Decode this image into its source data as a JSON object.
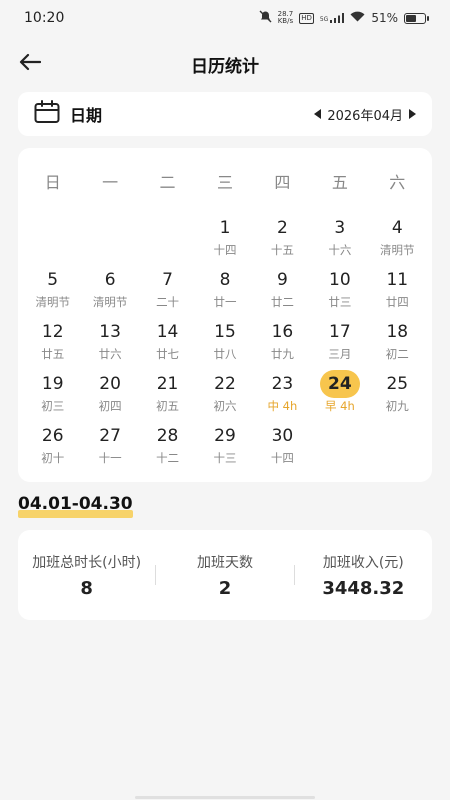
{
  "status_bar": {
    "time": "10:20",
    "net_speed_value": "28.7",
    "net_speed_unit": "KB/s",
    "hd_badge": "HD",
    "signal_label": "5G",
    "battery_text": "51%",
    "battery_level": 0.51,
    "icons": [
      "mute-icon",
      "hd-icon",
      "signal-icon",
      "wifi-icon",
      "battery-icon"
    ]
  },
  "header": {
    "title": "日历统计",
    "back_icon": "arrow-left-icon"
  },
  "date_bar": {
    "label": "日期",
    "icon": "calendar-icon",
    "month": "2026年04月"
  },
  "calendar": {
    "weekdays": [
      "日",
      "一",
      "二",
      "三",
      "四",
      "五",
      "六"
    ],
    "accent_color": "#f7c54d",
    "overtime_color": "#e6a52b",
    "days": [
      {
        "day": "",
        "sub": ""
      },
      {
        "day": "",
        "sub": ""
      },
      {
        "day": "",
        "sub": ""
      },
      {
        "day": "1",
        "sub": "十四"
      },
      {
        "day": "2",
        "sub": "十五"
      },
      {
        "day": "3",
        "sub": "十六"
      },
      {
        "day": "4",
        "sub": "清明节"
      },
      {
        "day": "5",
        "sub": "清明节"
      },
      {
        "day": "6",
        "sub": "清明节"
      },
      {
        "day": "7",
        "sub": "二十"
      },
      {
        "day": "8",
        "sub": "廿一"
      },
      {
        "day": "9",
        "sub": "廿二"
      },
      {
        "day": "10",
        "sub": "廿三"
      },
      {
        "day": "11",
        "sub": "廿四"
      },
      {
        "day": "12",
        "sub": "廿五"
      },
      {
        "day": "13",
        "sub": "廿六"
      },
      {
        "day": "14",
        "sub": "廿七"
      },
      {
        "day": "15",
        "sub": "廿八"
      },
      {
        "day": "16",
        "sub": "廿九"
      },
      {
        "day": "17",
        "sub": "三月"
      },
      {
        "day": "18",
        "sub": "初二"
      },
      {
        "day": "19",
        "sub": "初三"
      },
      {
        "day": "20",
        "sub": "初四"
      },
      {
        "day": "21",
        "sub": "初五"
      },
      {
        "day": "22",
        "sub": "初六"
      },
      {
        "day": "23",
        "sub": "中 4h",
        "overtime": true
      },
      {
        "day": "24",
        "sub": "早 4h",
        "overtime": true,
        "selected": true
      },
      {
        "day": "25",
        "sub": "初九"
      },
      {
        "day": "26",
        "sub": "初十"
      },
      {
        "day": "27",
        "sub": "十一"
      },
      {
        "day": "28",
        "sub": "十二"
      },
      {
        "day": "29",
        "sub": "十三"
      },
      {
        "day": "30",
        "sub": "十四"
      }
    ]
  },
  "range": {
    "text": "04.01-04.30"
  },
  "stats": [
    {
      "label": "加班总时长(小时)",
      "value": "8"
    },
    {
      "label": "加班天数",
      "value": "2"
    },
    {
      "label": "加班收入(元)",
      "value": "3448.32"
    }
  ]
}
